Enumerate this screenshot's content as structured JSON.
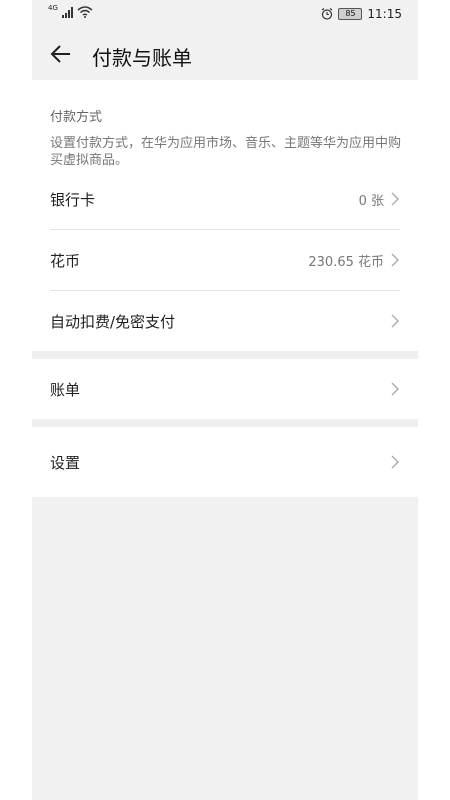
{
  "status_bar": {
    "network": "4G",
    "battery": "85",
    "time": "11:15"
  },
  "header": {
    "title": "付款与账单"
  },
  "payment_section": {
    "title": "付款方式",
    "description": "设置付款方式，在华为应用市场、音乐、主题等华为应用中购买虚拟商品。",
    "rows": [
      {
        "label": "银行卡",
        "value": "0 张"
      },
      {
        "label": "花币",
        "value": "230.65 花币"
      },
      {
        "label": "自动扣费/免密支付",
        "value": ""
      }
    ]
  },
  "bill_row": {
    "label": "账单"
  },
  "settings_row": {
    "label": "设置"
  },
  "colors": {
    "background": "#ffffff",
    "frame": "#f1f1f1",
    "text": "#1f1f1f",
    "muted": "#777777"
  },
  "icons": [
    "back-arrow-icon",
    "chevron-right-icon",
    "alarm-icon",
    "signal-icon",
    "wifi-icon",
    "battery-icon"
  ]
}
